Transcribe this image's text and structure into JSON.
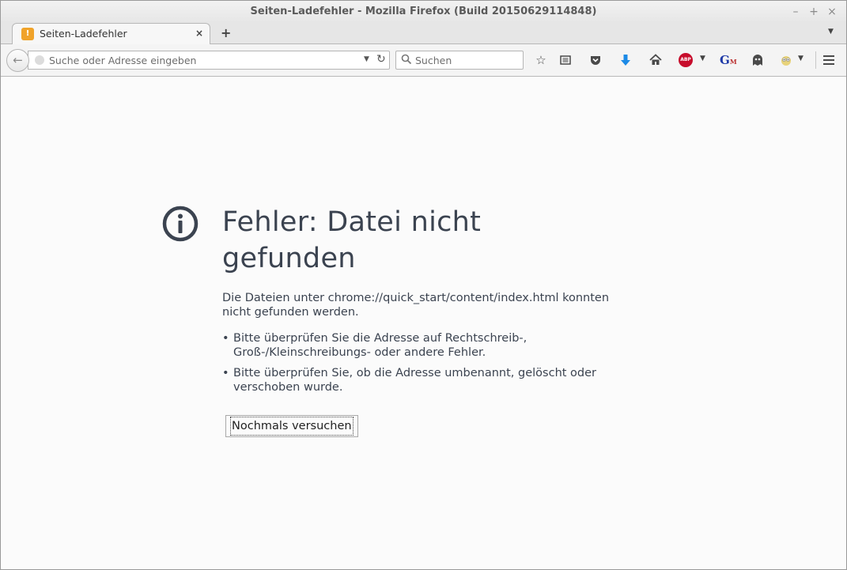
{
  "window": {
    "title": "Seiten-Ladefehler - Mozilla Firefox (Build 20150629114848)",
    "minimize": "–",
    "maximize": "+",
    "close": "×"
  },
  "tabs": [
    {
      "label": "Seiten-Ladefehler",
      "close": "×",
      "active": true
    }
  ],
  "tabstrip": {
    "new_tab": "+",
    "list_tabs": "▼"
  },
  "navbar": {
    "back": "←",
    "url_placeholder": "Suche oder Adresse eingeben",
    "url_value": "",
    "search_placeholder": "Suchen",
    "search_value": "",
    "icons": [
      "star-icon",
      "reader-list-icon",
      "pocket-icon",
      "download-icon",
      "home-icon",
      "adblock-plus-icon",
      "translate-icon",
      "ghostery-icon",
      "owl-icon",
      "menu-icon"
    ]
  },
  "error": {
    "title": "Fehler: Datei nicht gefunden",
    "description": "Die Dateien unter chrome://quick_start/content/index.html konnten nicht gefunden werden.",
    "tips": [
      "Bitte überprüfen Sie die Adresse auf Rechtschreib-, Groß-/Kleinschreibungs- oder andere Fehler.",
      "Bitte überprüfen Sie, ob die Adresse umbenannt, gelöscht oder verschoben wurde."
    ],
    "retry_label": "Nochmals versuchen"
  },
  "colors": {
    "error_text": "#3b4350",
    "download_blue": "#1c8ae6",
    "abp_red": "#c70d2c",
    "favicon_orange": "#f0a32a"
  }
}
